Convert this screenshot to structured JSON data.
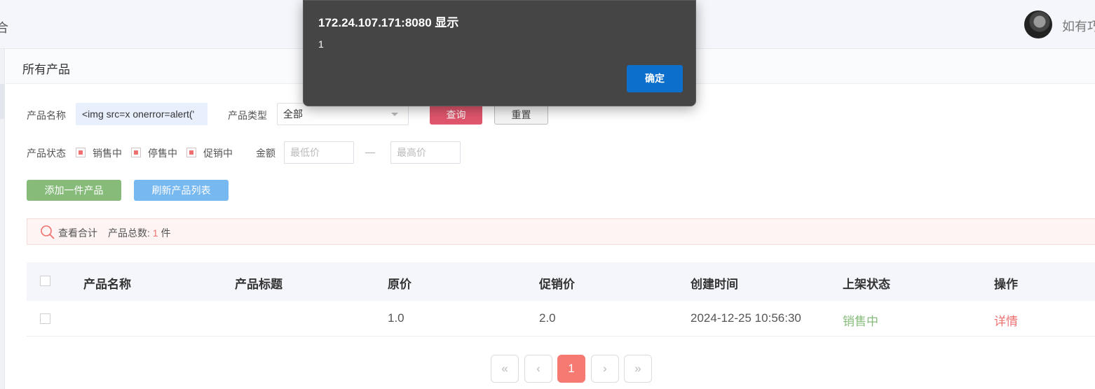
{
  "header": {
    "truncated_left_text": "合",
    "username": "如有巧"
  },
  "panel": {
    "title": "所有产品"
  },
  "filters": {
    "name_label": "产品名称",
    "name_value": "<img src=x onerror=alert('",
    "type_label": "产品类型",
    "type_value": "全部",
    "query_label": "查询",
    "reset_label": "重置",
    "status_label": "产品状态",
    "status_options": [
      "销售中",
      "停售中",
      "促销中"
    ],
    "amount_label": "金额",
    "min_placeholder": "最低价",
    "range_sep": "—",
    "max_placeholder": "最高价"
  },
  "actions": {
    "add_label": "添加一件产品",
    "refresh_label": "刷新产品列表"
  },
  "summary": {
    "view_total": "查看合计",
    "count_label": "产品总数:",
    "count_value": "1",
    "count_unit": "件"
  },
  "table": {
    "headers": [
      "产品名称",
      "产品标题",
      "原价",
      "促销价",
      "创建时间",
      "上架状态",
      "操作"
    ],
    "rows": [
      {
        "name": "",
        "title": "",
        "price": "1.0",
        "promo_price": "2.0",
        "created": "2024-12-25 10:56:30",
        "status": "销售中",
        "action": "详情"
      }
    ]
  },
  "pagination": {
    "first": "«",
    "prev": "‹",
    "current": "1",
    "next": "›",
    "last": "»"
  },
  "dialog": {
    "title": "172.24.107.171:8080 显示",
    "message": "1",
    "ok_label": "确定"
  },
  "colors": {
    "query_button": "#e0566c",
    "add_button": "#86bb7a",
    "refresh_button": "#76b8ef",
    "status_green": "#86bb7a",
    "accent_red": "#f07070",
    "dialog_bg": "#454545",
    "dialog_ok": "#0b6fcb"
  }
}
